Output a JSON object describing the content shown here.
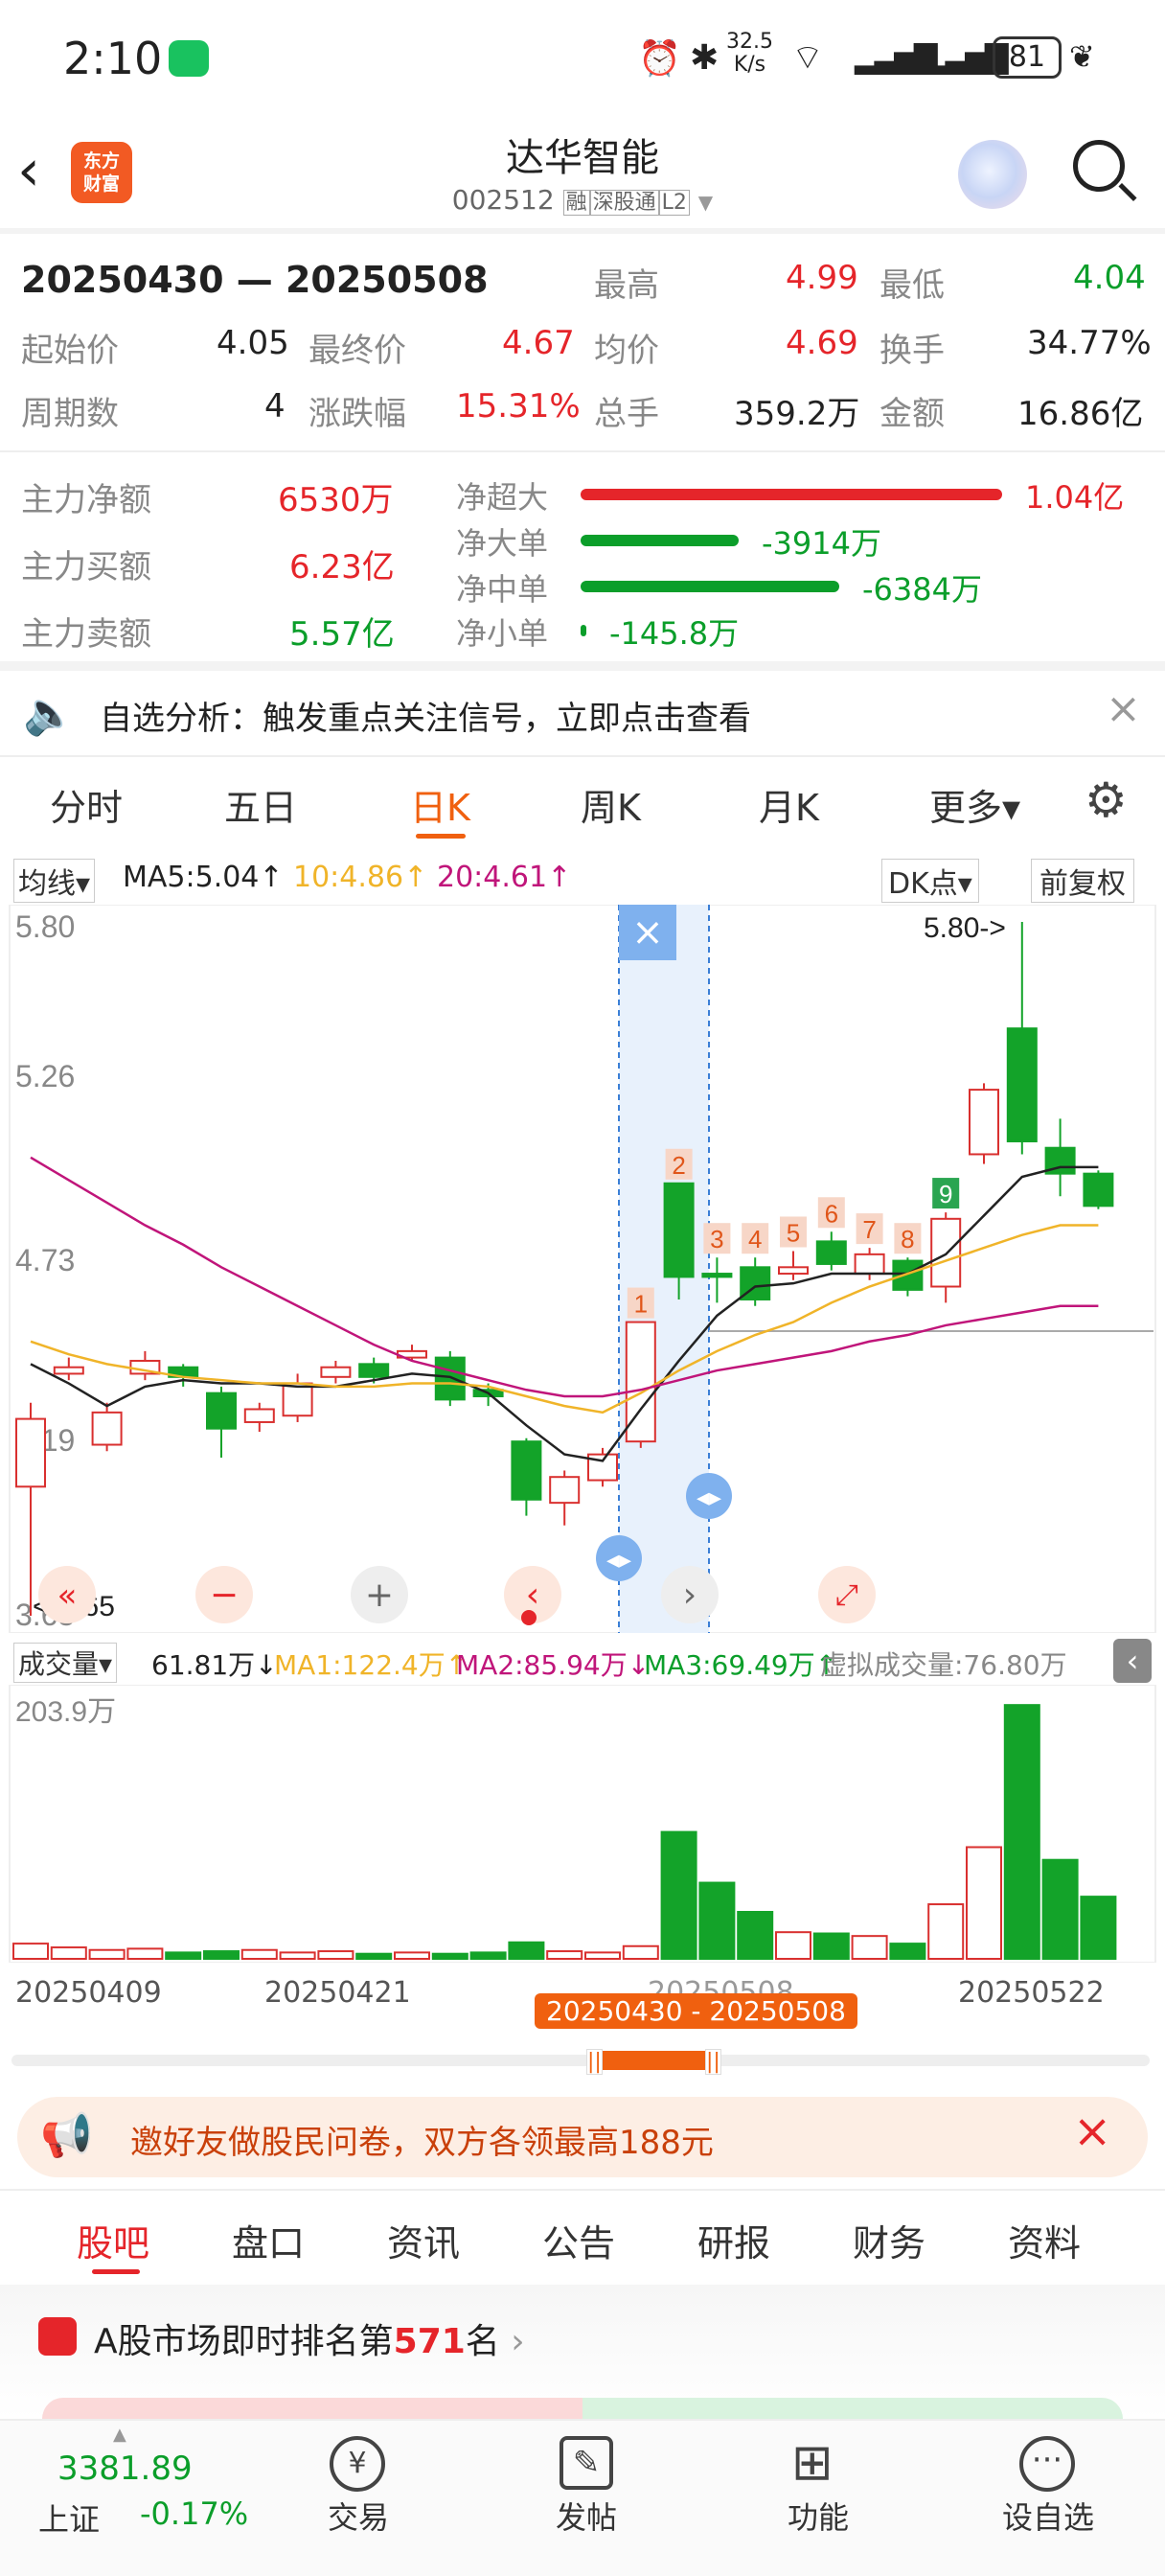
{
  "status": {
    "time": "2:10",
    "net_speed_top": "32.5",
    "net_speed_bot": "K/s",
    "battery": "81"
  },
  "header": {
    "title": "达华智能",
    "code": "002512",
    "tag_margin": "融",
    "tag_market": "深股通",
    "tag_level": "L2",
    "logo_line1": "东方",
    "logo_line2": "财富"
  },
  "period": {
    "range": "20250430 — 20250508",
    "high_label": "最高",
    "high": "4.99",
    "low_label": "最低",
    "low": "4.04",
    "open_label": "起始价",
    "open": "4.05",
    "close_label": "最终价",
    "close": "4.67",
    "avg_label": "均价",
    "avg": "4.69",
    "turnover_label": "换手",
    "turnover": "34.77%",
    "count_label": "周期数",
    "count": "4",
    "chg_label": "涨跌幅",
    "chg": "15.31%",
    "vol_label": "总手",
    "vol": "359.2万",
    "amt_label": "金额",
    "amt": "16.86亿"
  },
  "flows": {
    "net_label": "主力净额",
    "net": "6530万",
    "buy_label": "主力买额",
    "buy": "6.23亿",
    "sell_label": "主力卖额",
    "sell": "5.57亿",
    "items": [
      {
        "label": "净超大",
        "value": "1.04亿",
        "ratio": 1.0,
        "color": "#e5252a"
      },
      {
        "label": "净大单",
        "value": "-3914万",
        "ratio": 0.376,
        "color": "#0b9e2a"
      },
      {
        "label": "净中单",
        "value": "-6384万",
        "ratio": 0.614,
        "color": "#0b9e2a"
      },
      {
        "label": "净小单",
        "value": "-145.8万",
        "ratio": 0.014,
        "color": "#0b9e2a"
      }
    ]
  },
  "notice": {
    "text": "自选分析：触发重点关注信号，立即点击查看"
  },
  "ktabs": [
    "分时",
    "五日",
    "日K",
    "周K",
    "月K",
    "更多▾"
  ],
  "ma_bar": {
    "select": "均线▾",
    "ma5": "MA5:5.04↑",
    "ma10": "10:4.86↑",
    "ma20": "20:4.61↑",
    "dk": "DK点▾",
    "fq": "前复权"
  },
  "chart_labels": {
    "top": "5.80",
    "upper": "5.26",
    "mid": "4.73",
    "lower": "4.19",
    "bottom": "3.65",
    "max_note": "5.80->",
    "min_note": "<-3.65"
  },
  "vol_bar": {
    "select": "成交量▾",
    "vol": "61.81万↓",
    "ma1": "MA1:122.4万↑",
    "ma2": "MA2:85.94万↓",
    "ma3": "MA3:69.49万↑",
    "virtual": "虚拟成交量:76.80万",
    "max": "203.9万"
  },
  "x_dates": [
    "20250409",
    "20250421",
    "20250508",
    "20250522"
  ],
  "selected_range": "20250430 - 20250508",
  "ad": {
    "text": "邀好友做股民问卷，双方各领最高188元"
  },
  "bottom_tabs": [
    "股吧",
    "盘口",
    "资讯",
    "公告",
    "研报",
    "财务",
    "资料"
  ],
  "rank": {
    "prefix": "A股市场即时排名第",
    "num": "571",
    "suffix": "名"
  },
  "dock": {
    "index_value": "3381.89",
    "index_name": "上证",
    "index_chg": "-0.17%",
    "items": [
      "交易",
      "发帖",
      "功能",
      "设自选"
    ]
  },
  "chart_data": {
    "type": "candlestick",
    "ylim": [
      3.65,
      5.8
    ],
    "candles": [
      {
        "o": 4.05,
        "c": 4.26,
        "h": 4.31,
        "l": 3.65
      },
      {
        "o": 4.4,
        "c": 4.42,
        "h": 4.45,
        "l": 4.38
      },
      {
        "o": 4.18,
        "c": 4.28,
        "h": 4.31,
        "l": 4.16
      },
      {
        "o": 4.4,
        "c": 4.44,
        "h": 4.47,
        "l": 4.38
      },
      {
        "o": 4.42,
        "c": 4.39,
        "h": 4.43,
        "l": 4.36
      },
      {
        "o": 4.34,
        "c": 4.23,
        "h": 4.36,
        "l": 4.14
      },
      {
        "o": 4.25,
        "c": 4.29,
        "h": 4.31,
        "l": 4.22
      },
      {
        "o": 4.27,
        "c": 4.37,
        "h": 4.4,
        "l": 4.25
      },
      {
        "o": 4.39,
        "c": 4.42,
        "h": 4.44,
        "l": 4.37
      },
      {
        "o": 4.43,
        "c": 4.39,
        "h": 4.45,
        "l": 4.37
      },
      {
        "o": 4.45,
        "c": 4.47,
        "h": 4.49,
        "l": 4.44
      },
      {
        "o": 4.45,
        "c": 4.32,
        "h": 4.47,
        "l": 4.3
      },
      {
        "o": 4.35,
        "c": 4.33,
        "h": 4.37,
        "l": 4.3
      },
      {
        "o": 4.19,
        "c": 4.01,
        "h": 4.2,
        "l": 3.96
      },
      {
        "o": 4.0,
        "c": 4.08,
        "h": 4.1,
        "l": 3.93
      },
      {
        "o": 4.07,
        "c": 4.15,
        "h": 4.17,
        "l": 4.05
      },
      {
        "o": 4.19,
        "c": 4.56,
        "h": 4.56,
        "l": 4.17
      },
      {
        "o": 4.99,
        "c": 4.7,
        "h": 4.99,
        "l": 4.63
      },
      {
        "o": 4.71,
        "c": 4.7,
        "h": 4.76,
        "l": 4.62
      },
      {
        "o": 4.73,
        "c": 4.63,
        "h": 4.76,
        "l": 4.61
      },
      {
        "o": 4.71,
        "c": 4.73,
        "h": 4.78,
        "l": 4.69
      },
      {
        "o": 4.81,
        "c": 4.74,
        "h": 4.84,
        "l": 4.72
      },
      {
        "o": 4.71,
        "c": 4.77,
        "h": 4.79,
        "l": 4.69
      },
      {
        "o": 4.75,
        "c": 4.66,
        "h": 4.76,
        "l": 4.64
      },
      {
        "o": 4.67,
        "c": 4.88,
        "h": 4.9,
        "l": 4.62
      },
      {
        "o": 5.08,
        "c": 5.28,
        "h": 5.3,
        "l": 5.05
      },
      {
        "o": 5.47,
        "c": 5.12,
        "h": 5.8,
        "l": 5.08
      },
      {
        "o": 5.1,
        "c": 5.02,
        "h": 5.19,
        "l": 4.95
      },
      {
        "o": 5.02,
        "c": 4.92,
        "h": 5.03,
        "l": 4.91
      }
    ],
    "labels": {
      "16": "1",
      "17": "2",
      "18": "3",
      "19": "4",
      "20": "5",
      "21": "6",
      "22": "7",
      "23": "8",
      "24": "9"
    },
    "volume": [
      12,
      9,
      7,
      8,
      5,
      6,
      7,
      5,
      6,
      4,
      5,
      4,
      5,
      13,
      6,
      5,
      10,
      100,
      60,
      37,
      21,
      20,
      18,
      12,
      43,
      88,
      200,
      78,
      49
    ],
    "ma_lines": {
      "ma5": [
        4.43,
        4.37,
        4.3,
        4.36,
        4.38,
        4.37,
        4.37,
        4.36,
        4.36,
        4.38,
        4.4,
        4.39,
        4.34,
        4.24,
        4.15,
        4.13,
        4.29,
        4.44,
        4.58,
        4.67,
        4.68,
        4.71,
        4.71,
        4.71,
        4.77,
        4.89,
        5.01,
        5.04,
        5.04
      ],
      "ma10": [
        4.5,
        4.46,
        4.43,
        4.41,
        4.39,
        4.38,
        4.37,
        4.37,
        4.36,
        4.36,
        4.37,
        4.37,
        4.36,
        4.33,
        4.3,
        4.28,
        4.34,
        4.41,
        4.47,
        4.52,
        4.56,
        4.62,
        4.67,
        4.71,
        4.75,
        4.79,
        4.83,
        4.86,
        4.86
      ],
      "ma20": [
        5.07,
        5.0,
        4.93,
        4.86,
        4.8,
        4.73,
        4.67,
        4.61,
        4.55,
        4.49,
        4.44,
        4.41,
        4.38,
        4.35,
        4.33,
        4.33,
        4.35,
        4.38,
        4.41,
        4.43,
        4.45,
        4.47,
        4.5,
        4.52,
        4.55,
        4.57,
        4.59,
        4.61,
        4.61
      ]
    }
  }
}
